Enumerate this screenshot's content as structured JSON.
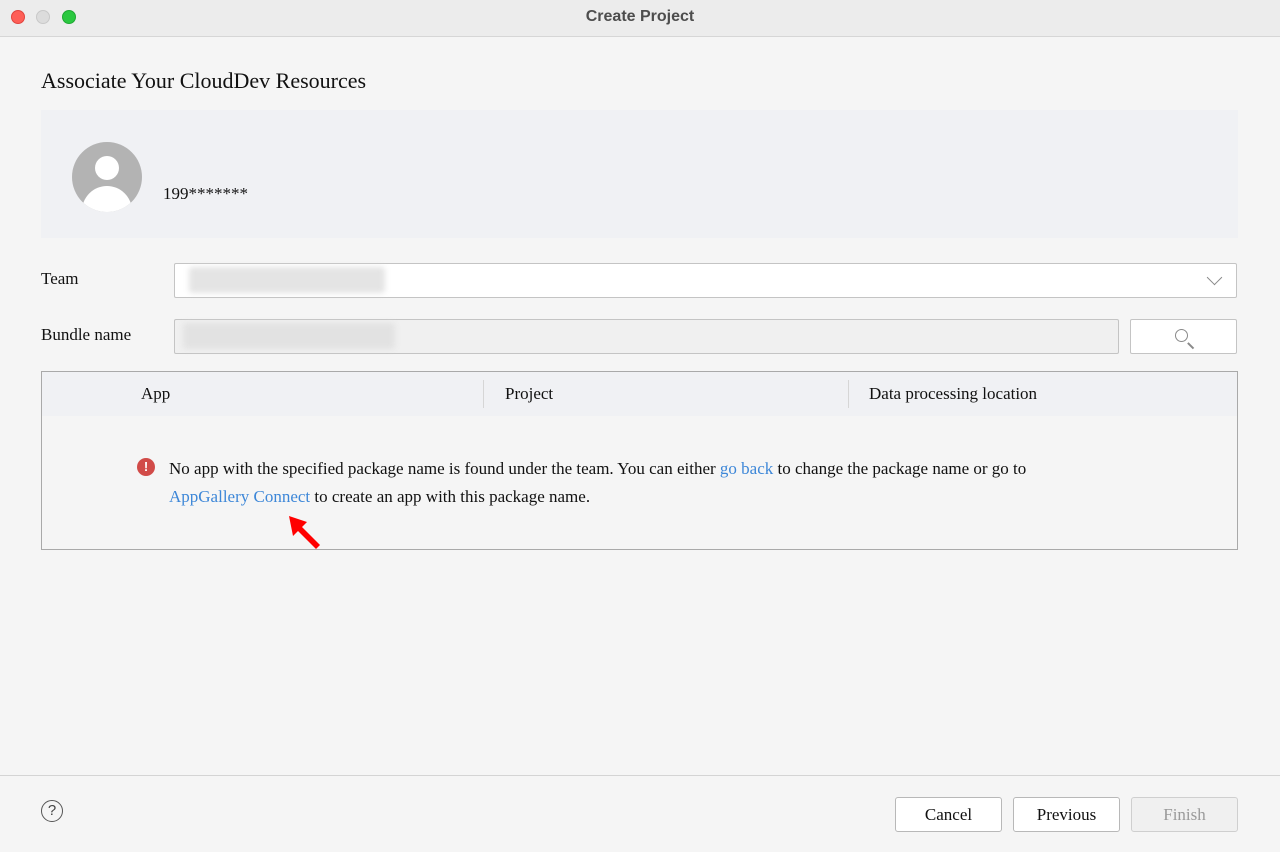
{
  "window": {
    "title": "Create Project"
  },
  "page": {
    "heading": "Associate Your CloudDev Resources"
  },
  "account": {
    "name": "199*******"
  },
  "form": {
    "team_label": "Team",
    "team_value": "",
    "bundle_label": "Bundle name",
    "bundle_value": ""
  },
  "table": {
    "columns": [
      "App",
      "Project",
      "Data processing location"
    ]
  },
  "error": {
    "part1": "No app with the specified package name is found under the team. You can either ",
    "link1": "go back",
    "part2": " to change the package name or go to ",
    "link2": "AppGallery Connect",
    "part3": " to create an app with this package name."
  },
  "footer": {
    "help": "?",
    "cancel": "Cancel",
    "previous": "Previous",
    "finish": "Finish"
  },
  "colors": {
    "link": "#3d87d8",
    "error": "#d14b48",
    "annotation_arrow": "#ff0000"
  }
}
